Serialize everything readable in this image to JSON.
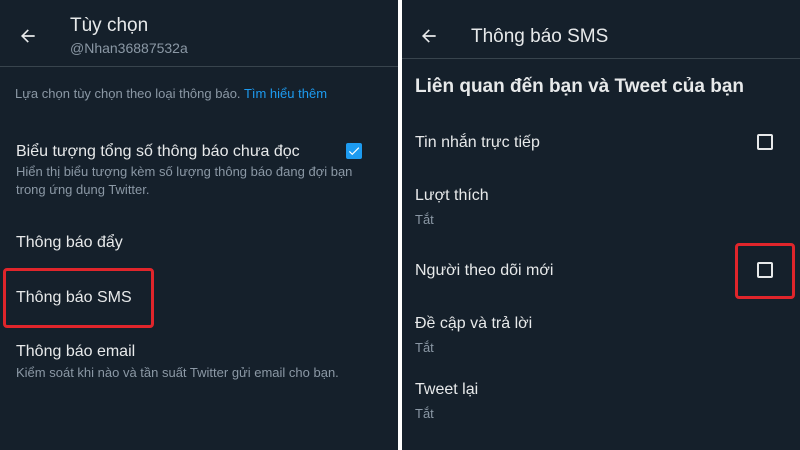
{
  "left": {
    "title": "Tùy chọn",
    "handle": "@Nhan36887532a",
    "intro_text": "Lựa chọn tùy chọn theo loại thông báo.",
    "intro_link": "Tìm hiểu thêm",
    "unread_badge": {
      "title": "Biểu tượng tổng số thông báo chưa đọc",
      "description": "Hiển thị biểu tượng kèm số lượng thông báo đang đợi bạn trong ứng dụng Twitter.",
      "checked": true
    },
    "push": {
      "title": "Thông báo đẩy"
    },
    "sms": {
      "title": "Thông báo SMS"
    },
    "email": {
      "title": "Thông báo email",
      "description": "Kiểm soát khi nào và tần suất Twitter gửi email cho bạn."
    }
  },
  "right": {
    "title": "Thông báo SMS",
    "section_heading": "Liên quan đến bạn và Tweet của bạn",
    "items": [
      {
        "label": "Tin nhắn trực tiếp",
        "checkbox": true,
        "checked": false
      },
      {
        "label": "Lượt thích",
        "sub": "Tắt"
      },
      {
        "label": "Người theo dõi mới",
        "checkbox": true,
        "checked": false
      },
      {
        "label": "Đề cập và trả lời",
        "sub": "Tắt"
      },
      {
        "label": "Tweet lại",
        "sub": "Tắt"
      }
    ]
  },
  "colors": {
    "background": "#15202b",
    "accent": "#1d9bf0",
    "highlight": "#e0252b",
    "secondary_text": "#8b98a5"
  }
}
